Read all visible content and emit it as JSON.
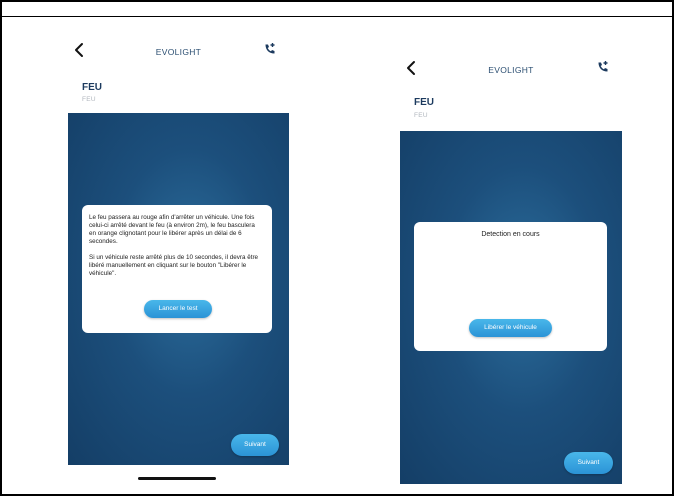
{
  "screens": [
    {
      "header": {
        "title": "EVOLIGHT",
        "back_icon": "chevron-left-icon",
        "call_icon": "phone-plus-icon"
      },
      "section": {
        "title": "FEU",
        "subtitle": "FEU"
      },
      "dialog": {
        "paragraph1": "Le feu passera au rouge afin d'arrêter un véhicule. Une fois celui-ci arrêté devant le feu (à environ 2m), le feu basculera en orange clignotant pour le libérer après un délai de 6 secondes.",
        "paragraph2": "Si un véhicule reste arrêté plus de 10 secondes, il devra être libéré manuellement en cliquant sur le bouton \"Libérer le véhicule\".",
        "button_label": "Lancer le test"
      },
      "next_label": "Suivant"
    },
    {
      "header": {
        "title": "EVOLIGHT",
        "back_icon": "chevron-left-icon",
        "call_icon": "phone-plus-icon"
      },
      "section": {
        "title": "FEU",
        "subtitle": "FEU"
      },
      "dialog": {
        "status": "Detection en cours",
        "button_label": "Libérer le véhicule"
      },
      "next_label": "Suivant"
    }
  ],
  "colors": {
    "accent": "#2b93d6",
    "background_dark": "#143e66",
    "title": "#1c3a5e"
  }
}
